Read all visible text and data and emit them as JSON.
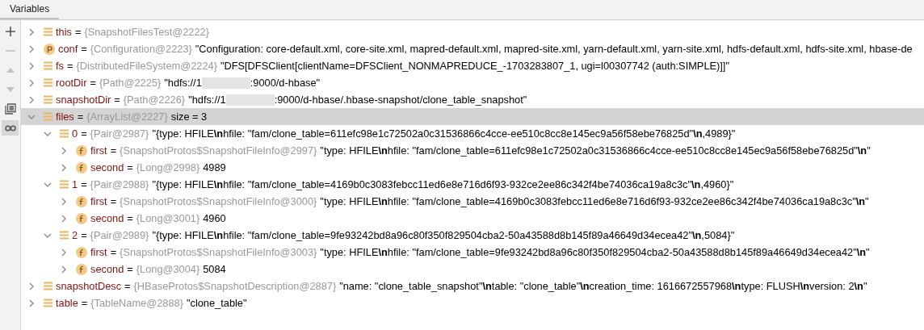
{
  "tab": {
    "label": "Variables",
    "selected": true
  },
  "toolbar": [
    {
      "kind": "add",
      "disabled": false,
      "selected": false
    },
    {
      "kind": "remove",
      "disabled": true,
      "selected": false
    },
    {
      "kind": "up",
      "disabled": true,
      "selected": false
    },
    {
      "kind": "down",
      "disabled": true,
      "selected": false
    },
    {
      "kind": "copy",
      "disabled": false,
      "selected": false
    },
    {
      "kind": "glasses",
      "disabled": false,
      "selected": true
    }
  ],
  "variables": [
    {
      "kind": "list",
      "name": "this",
      "equals": "=",
      "type": "{SnapshotFilesTest@2222}",
      "expanded": false,
      "selected": false
    },
    {
      "kind": "p",
      "name": "conf",
      "equals": "=",
      "type": "{Configuration@2223}",
      "value": "\"Configuration: core-default.xml, core-site.xml, mapred-default.xml, mapred-site.xml, yarn-default.xml, yarn-site.xml, hdfs-default.xml, hdfs-site.xml, hbase-de",
      "expanded": false,
      "selected": false
    },
    {
      "kind": "list",
      "name": "fs",
      "equals": "=",
      "type": "{DistributedFileSystem@2224}",
      "value": "\"DFS[DFSClient[clientName=DFSClient_NONMAPREDUCE_-1703283807_1, ugi=l00307742 (auth:SIMPLE)]]\"",
      "expanded": false,
      "selected": false
    },
    {
      "kind": "list",
      "name": "rootDir",
      "equals": "=",
      "type": "{Path@2225}",
      "value": "\"hdfs://1",
      "redacted": true,
      "value_tail": ":9000/d-hbase\"",
      "expanded": false,
      "selected": false
    },
    {
      "kind": "list",
      "name": "snapshotDir",
      "equals": "=",
      "type": "{Path@2226}",
      "value": "\"hdfs://1",
      "redacted": true,
      "value_tail": ":9000/d-hbase/.hbase-snapshot/clone_table_snapshot\"",
      "expanded": false,
      "selected": false
    },
    {
      "kind": "list",
      "name": "files",
      "equals": "=",
      "type": "{ArrayList@2227}",
      "value": " size = 3",
      "expanded": true,
      "selected": true,
      "children": [
        {
          "kind": "list",
          "name": "0",
          "equals": "=",
          "type": "{Pair@2987}",
          "value": "\"{type: HFILE**\\n**hfile: \"fam/clone_table=611efc98e1c72502a0c31536866c4cce-ee510c8cc8e145ec9a56f58ebe76825d\"**\\n**,4989}\"",
          "expanded": true,
          "selected": false,
          "children": [
            {
              "kind": "f",
              "name": "first",
              "equals": "=",
              "type": "{SnapshotProtos$SnapshotFileInfo@2997}",
              "value": "\"type: HFILE**\\n**hfile: \"fam/clone_table=611efc98e1c72502a0c31536866c4cce-ee510c8cc8e145ec9a56f58ebe76825d\"**\\n**\"",
              "expanded": false,
              "selected": false
            },
            {
              "kind": "f",
              "name": "second",
              "equals": "=",
              "type": "{Long@2998}",
              "value": "4989",
              "expanded": false,
              "selected": false
            }
          ]
        },
        {
          "kind": "list",
          "name": "1",
          "equals": "=",
          "type": "{Pair@2988}",
          "value": "\"{type: HFILE**\\n**hfile: \"fam/clone_table=4169b0c3083febcc11ed6e8e716d6f93-932ce2ee86c342f4be74036ca19a8c3c\"**\\n**,4960}\"",
          "expanded": true,
          "selected": false,
          "children": [
            {
              "kind": "f",
              "name": "first",
              "equals": "=",
              "type": "{SnapshotProtos$SnapshotFileInfo@3000}",
              "value": "\"type: HFILE**\\n**hfile: \"fam/clone_table=4169b0c3083febcc11ed6e8e716d6f93-932ce2ee86c342f4be74036ca19a8c3c\"**\\n**\"",
              "expanded": false,
              "selected": false
            },
            {
              "kind": "f",
              "name": "second",
              "equals": "=",
              "type": "{Long@3001}",
              "value": "4960",
              "expanded": false,
              "selected": false
            }
          ]
        },
        {
          "kind": "list",
          "name": "2",
          "equals": "=",
          "type": "{Pair@2989}",
          "value": "\"{type: HFILE**\\n**hfile: \"fam/clone_table=9fe93242bd8a96c80f350f829504cba2-50a43588d8b145f89a46649d34ecea42\"**\\n**,5084}\"",
          "expanded": true,
          "selected": false,
          "children": [
            {
              "kind": "f",
              "name": "first",
              "equals": "=",
              "type": "{SnapshotProtos$SnapshotFileInfo@3003}",
              "value": "\"type: HFILE**\\n**hfile: \"fam/clone_table=9fe93242bd8a96c80f350f829504cba2-50a43588d8b145f89a46649d34ecea42\"**\\n**\"",
              "expanded": false,
              "selected": false
            },
            {
              "kind": "f",
              "name": "second",
              "equals": "=",
              "type": "{Long@3004}",
              "value": "5084",
              "expanded": false,
              "selected": false
            }
          ]
        }
      ]
    },
    {
      "kind": "list",
      "name": "snapshotDesc",
      "equals": "=",
      "type": "{HBaseProtos$SnapshotDescription@2887}",
      "value": "\"name: \"clone_table_snapshot\"**\\n**table: \"clone_table\"**\\n**creation_time: 1616672557968**\\n**type: FLUSH**\\n**version: 2**\\n**\"",
      "expanded": false,
      "selected": false
    },
    {
      "kind": "list",
      "name": "table",
      "equals": "=",
      "type": "{TableName@2888}",
      "value": "\"clone_table\"",
      "expanded": false,
      "selected": false
    }
  ]
}
